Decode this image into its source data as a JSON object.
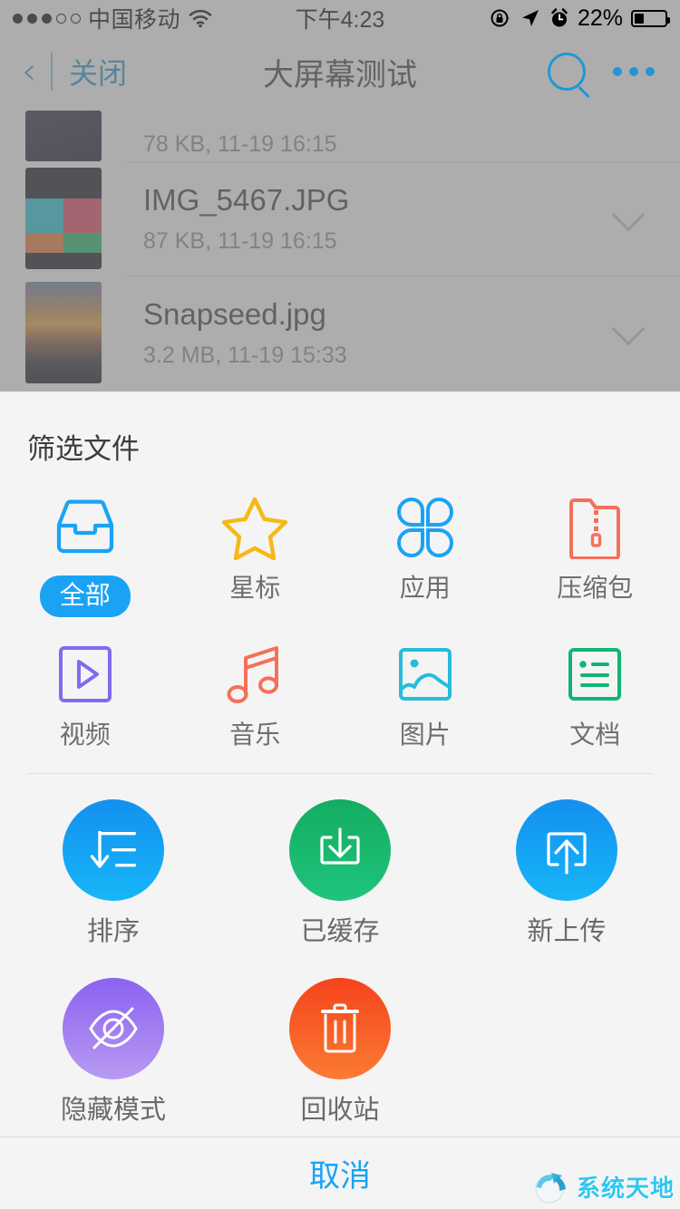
{
  "status_bar": {
    "signal_dots_filled": 3,
    "signal_dots_empty": 2,
    "carrier": "中国移动",
    "wifi_icon": "wifi-icon",
    "time": "下午4:23",
    "rotation_lock_icon": "rotation-lock-icon",
    "location_icon": "location-arrow-icon",
    "alarm_icon": "alarm-clock-icon",
    "battery_percent": "22%",
    "battery_level": 22
  },
  "nav_bar": {
    "back_icon": "chevron-left-icon",
    "close_label": "关闭",
    "title": "大屏幕测试",
    "search_icon": "search-icon",
    "more_icon": "more-dots-icon"
  },
  "file_list": [
    {
      "name": "",
      "sub": "78 KB, 11-19 16:15",
      "chevron": "chevron-down-icon"
    },
    {
      "name": "IMG_5467.JPG",
      "sub": "87 KB, 11-19 16:15",
      "chevron": "chevron-down-icon"
    },
    {
      "name": "Snapseed.jpg",
      "sub": "3.2 MB, 11-19 15:33",
      "chevron": "chevron-down-icon"
    }
  ],
  "sheet": {
    "title": "筛选文件",
    "filters": [
      {
        "label": "全部",
        "icon": "inbox-tray-icon",
        "color": "#1aa3f5",
        "selected": true
      },
      {
        "label": "星标",
        "icon": "star-icon",
        "color": "#f5b916",
        "selected": false
      },
      {
        "label": "应用",
        "icon": "apps-grid-icon",
        "color": "#1aa3f5",
        "selected": false
      },
      {
        "label": "压缩包",
        "icon": "zip-folder-icon",
        "color": "#f4705a",
        "selected": false
      },
      {
        "label": "视频",
        "icon": "video-play-icon",
        "color": "#7d6cf0",
        "selected": false
      },
      {
        "label": "音乐",
        "icon": "music-note-icon",
        "color": "#f4705a",
        "selected": false
      },
      {
        "label": "图片",
        "icon": "image-picture-icon",
        "color": "#26bcdb",
        "selected": false
      },
      {
        "label": "文档",
        "icon": "document-list-icon",
        "color": "#11b573",
        "selected": false
      }
    ],
    "actions": [
      {
        "label": "排序",
        "icon": "sort-descending-icon",
        "color": "#17a4f4"
      },
      {
        "label": "已缓存",
        "icon": "download-box-icon",
        "color": "#1bbd76"
      },
      {
        "label": "新上传",
        "icon": "upload-box-icon",
        "color": "#17a4f4"
      },
      {
        "label": "隐藏模式",
        "icon": "eye-slash-icon",
        "color": "#9b7af1"
      },
      {
        "label": "回收站",
        "icon": "trash-can-icon",
        "color": "#f8642a"
      }
    ],
    "cancel_label": "取消"
  },
  "watermark": {
    "text": "系统天地",
    "icon": "globe-logo-icon"
  }
}
